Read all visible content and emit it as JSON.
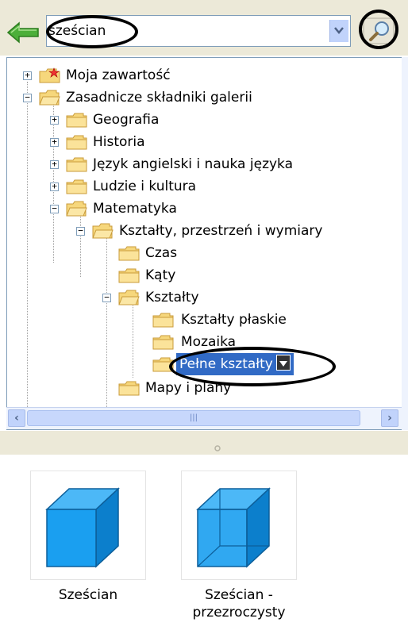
{
  "search": {
    "value": "sześcian"
  },
  "icons": {
    "back": "back-arrow-icon",
    "search_go": "magnifier-icon",
    "dropdown": "chevron-down-icon",
    "folder": "folder-icon",
    "star_folder": "star-folder-icon"
  },
  "tree": {
    "items": [
      {
        "label": "Moja zawartość"
      },
      {
        "label": "Zasadnicze składniki galerii"
      },
      {
        "label": "Geografia"
      },
      {
        "label": "Historia"
      },
      {
        "label": "Język angielski i nauka języka"
      },
      {
        "label": "Ludzie i kultura"
      },
      {
        "label": "Matematyka"
      },
      {
        "label": "Kształty, przestrzeń i wymiary"
      },
      {
        "label": "Czas"
      },
      {
        "label": "Kąty"
      },
      {
        "label": "Kształty"
      },
      {
        "label": "Kształty płaskie"
      },
      {
        "label": "Mozaika"
      },
      {
        "label": "Pełne kształty"
      },
      {
        "label": "Mapy i plany"
      }
    ]
  },
  "results": {
    "items": [
      {
        "label": "Sześcian"
      },
      {
        "label_line1": "Sześcian -",
        "label_line2": "przezroczysty"
      }
    ]
  },
  "colors": {
    "accent": "#316ac5",
    "cube": "#1a9ff0"
  }
}
